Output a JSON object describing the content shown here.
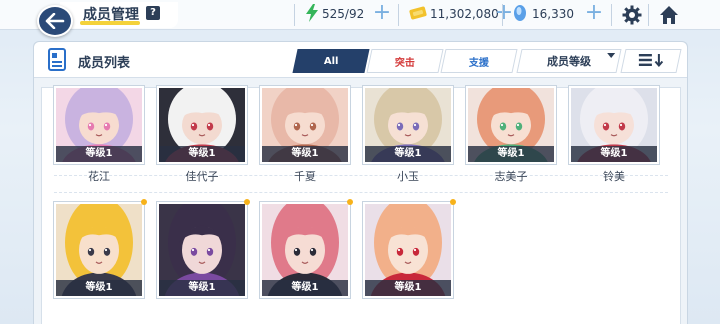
{
  "header": {
    "title": "成员管理",
    "help_label": "?",
    "icons": [
      "back-arrow-icon",
      "help-icon",
      "gear-icon",
      "home-icon"
    ]
  },
  "resources": {
    "stamina": {
      "value": "525/92",
      "icon": "lightning-icon",
      "color": "#35b55a"
    },
    "credits": {
      "value": "11,302,080",
      "icon": "credit-ticket-icon",
      "color": "#f2c22c"
    },
    "gems": {
      "value": "16,330",
      "icon": "gem-icon",
      "color": "#5aa0e8"
    }
  },
  "panel": {
    "title": "成员列表",
    "filters": {
      "all": "All",
      "attacker": "突击",
      "support": "支援"
    },
    "sort_label": "成员等级",
    "order_icon": "list-sort-icon"
  },
  "members": [
    {
      "name": "花江",
      "level": "等级1",
      "hair": "#c9b3e0",
      "skin": "#f7dcd0",
      "bg": "#f3d7e6",
      "accent": "#e67ab0"
    },
    {
      "name": "佳代子",
      "level": "等级1",
      "hair": "#f2f2f2",
      "skin": "#f3dad0",
      "bg": "#2e2f3a",
      "accent": "#c23a4a"
    },
    {
      "name": "千夏",
      "level": "等级1",
      "hair": "#e8b8a8",
      "skin": "#f6dcd0",
      "bg": "#f1d2c6",
      "accent": "#b0664e"
    },
    {
      "name": "小玉",
      "level": "等级1",
      "hair": "#d8c8a8",
      "skin": "#f6e0d4",
      "bg": "#e9e2d4",
      "accent": "#7a6bb8"
    },
    {
      "name": "志美子",
      "level": "等级1",
      "hair": "#e89a7a",
      "skin": "#f7dfd2",
      "bg": "#f1e2dc",
      "accent": "#4fb07a"
    },
    {
      "name": "铃美",
      "level": "等级1",
      "hair": "#eeeef4",
      "skin": "#f6e0d8",
      "bg": "#dde0ea",
      "accent": "#c23a4a"
    },
    {
      "name": "",
      "level": "等级1",
      "hair": "#f3c23a",
      "skin": "#f8e0cc",
      "bg": "#efe0c8",
      "accent": "#3a3a4a"
    },
    {
      "name": "",
      "level": "等级1",
      "hair": "#3a2f4a",
      "skin": "#f0d8d8",
      "bg": "#3a3448",
      "accent": "#7a4aa0"
    },
    {
      "name": "",
      "level": "等级1",
      "hair": "#e07a8a",
      "skin": "#f6dcd4",
      "bg": "#f0dde4",
      "accent": "#2b2b38"
    },
    {
      "name": "",
      "level": "等级1",
      "hair": "#f2b08a",
      "skin": "#f8e2d4",
      "bg": "#eadfe8",
      "accent": "#c8283a"
    }
  ]
}
